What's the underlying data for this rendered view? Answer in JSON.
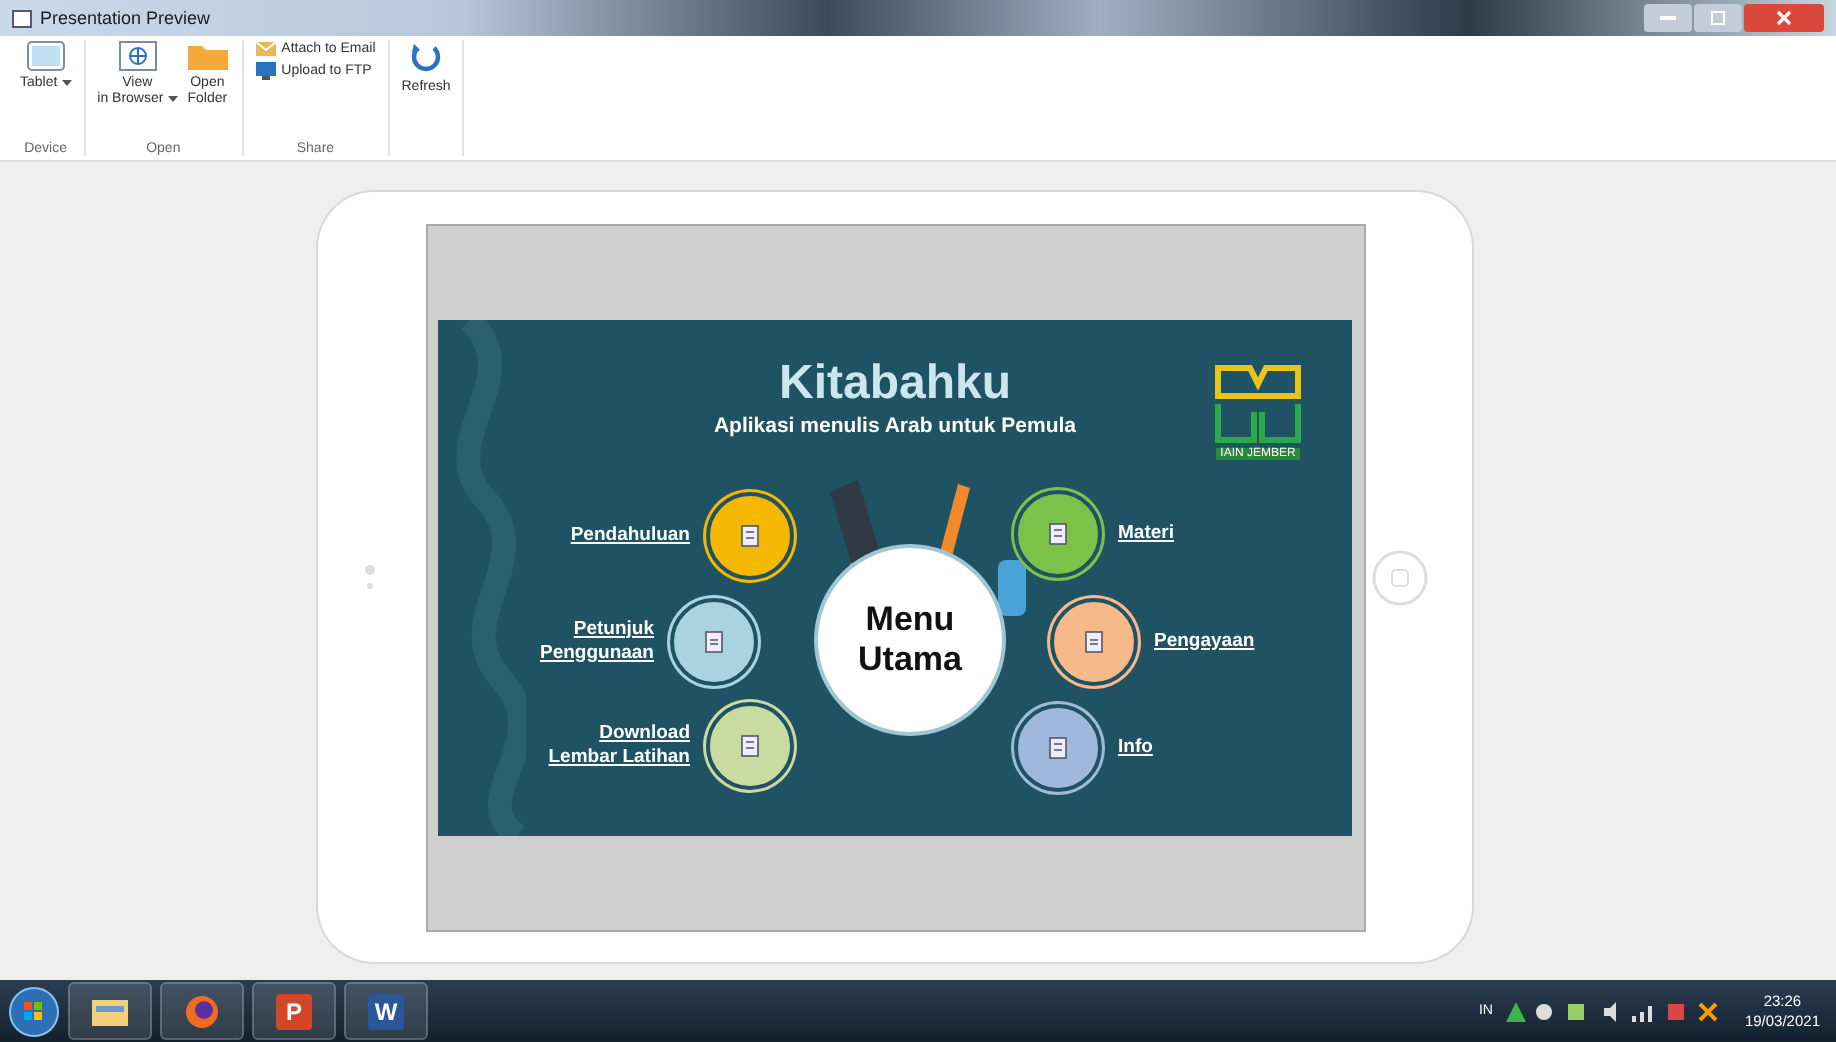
{
  "window": {
    "title": "Presentation Preview"
  },
  "ribbon": {
    "groups": [
      {
        "label": "Device",
        "buttons": [
          {
            "kind": "large",
            "label": "Tablet",
            "dropdown": true
          }
        ]
      },
      {
        "label": "Open",
        "buttons": [
          {
            "kind": "large",
            "label": "View\nin Browser",
            "dropdown": true
          },
          {
            "kind": "large",
            "label": "Open\nFolder",
            "dropdown": false
          }
        ]
      },
      {
        "label": "Share",
        "buttons": [
          {
            "kind": "small",
            "label": "Attach to Email",
            "dropdown": false
          },
          {
            "kind": "small",
            "label": "Upload to FTP",
            "dropdown": false
          }
        ]
      },
      {
        "buttons": [
          {
            "kind": "large",
            "label": "Refresh",
            "dropdown": false
          }
        ]
      }
    ]
  },
  "slide": {
    "title": "Kitabahku",
    "subtitle": "Aplikasi menulis Arab untuk Pemula",
    "logo_text": "IAIN JEMBER",
    "center": "Menu Utama",
    "left_items": [
      {
        "label": "Pendahuluan",
        "color": "#f5b800"
      },
      {
        "label": "Petunjuk\nPenggunaan",
        "color": "#a9d3de"
      },
      {
        "label": "Download\nLembar Latihan",
        "color": "#c9dba0"
      }
    ],
    "right_items": [
      {
        "label": "Materi",
        "color": "#7bc24a"
      },
      {
        "label": "Pengayaan",
        "color": "#f5b98a"
      },
      {
        "label": "Info",
        "color": "#9fb9dc"
      }
    ]
  },
  "taskbar": {
    "apps": [
      {
        "kind": "explorer"
      },
      {
        "kind": "firefox"
      },
      {
        "kind": "letter",
        "letter": "P",
        "color": "#d24726"
      },
      {
        "kind": "letter",
        "letter": "W",
        "color": "#2b579a"
      }
    ],
    "language": "IN",
    "time": "23:26",
    "date": "19/03/2021"
  }
}
